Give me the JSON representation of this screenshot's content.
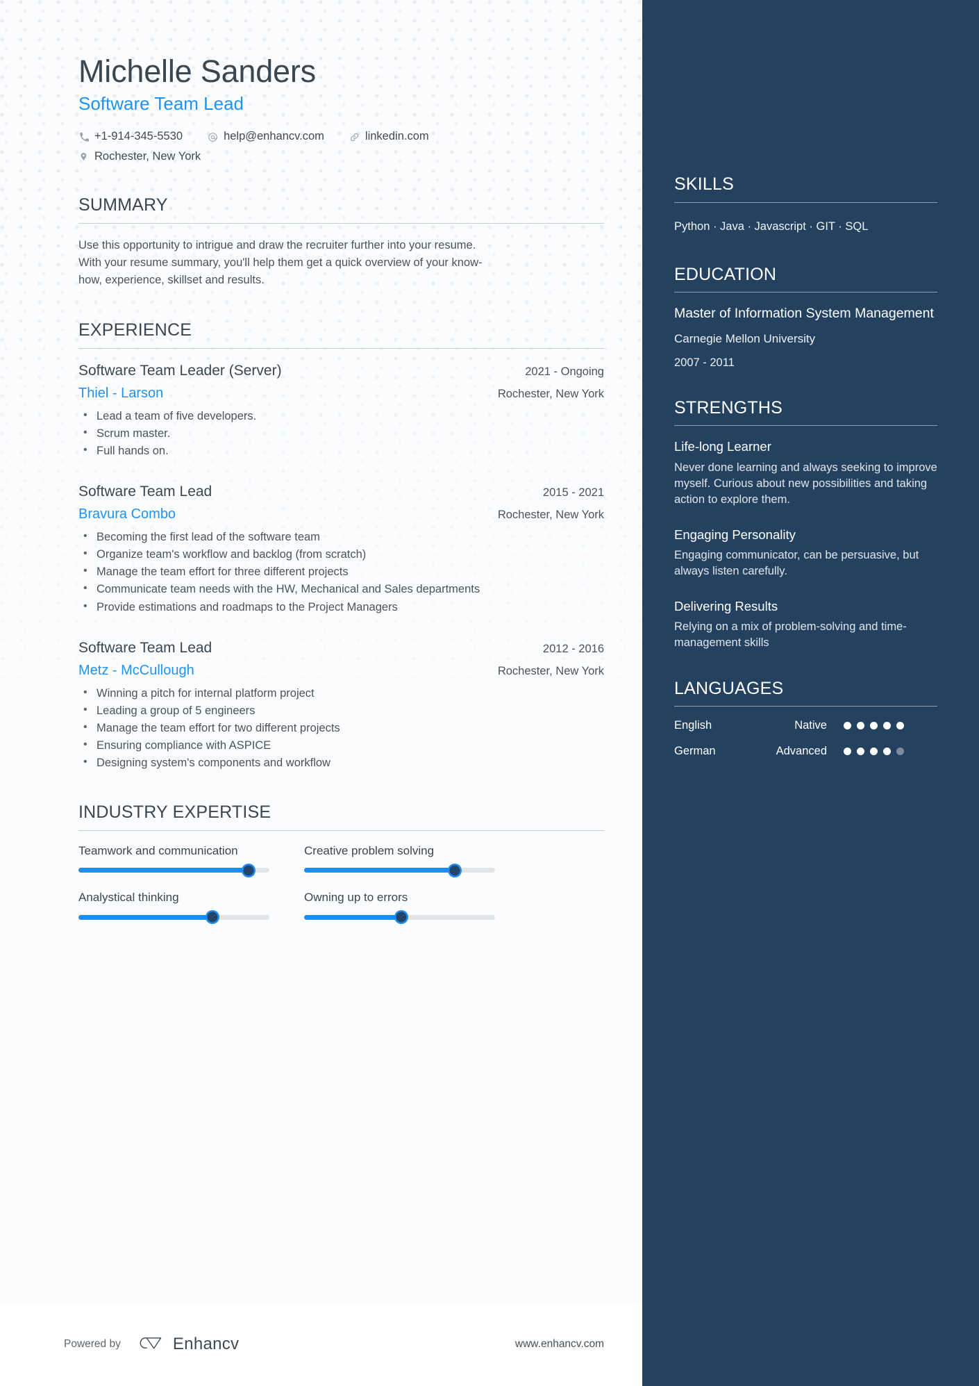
{
  "theme": {
    "accent_blue": "#1f93f2",
    "sidebar_navy": "#254160",
    "heading_gray": "#3a4750",
    "body_gray": "#4a545c"
  },
  "header": {
    "full_name": "Michelle Sanders",
    "job_title": "Software Team Lead",
    "contacts": [
      {
        "icon": "phone-icon",
        "value": "+1-914-345-5530"
      },
      {
        "icon": "email-icon",
        "value": "help@enhancv.com"
      },
      {
        "icon": "link-icon",
        "value": "linkedin.com"
      }
    ],
    "location": {
      "icon": "location-pin-icon",
      "value": "Rochester, New York"
    }
  },
  "summary": {
    "heading": "SUMMARY",
    "text": "Use this opportunity to intrigue and draw the recruiter further into your resume. With your resume summary, you'll help them get a quick overview of your know-how, experience, skillset and results."
  },
  "experience": {
    "heading": "EXPERIENCE",
    "items": [
      {
        "role": "Software Team Leader (Server)",
        "dates": "2021 - Ongoing",
        "company": "Thiel - Larson",
        "location": "Rochester, New York",
        "bullets": [
          "Lead a team of five developers.",
          "Scrum master.",
          "Full hands on."
        ]
      },
      {
        "role": "Software Team Lead",
        "dates": "2015 - 2021",
        "company": "Bravura Combo",
        "location": "Rochester, New York",
        "bullets": [
          "Becoming the first lead of the software team",
          "Organize team's workflow and backlog (from scratch)",
          "Manage the team effort for three different projects",
          "Communicate team needs with the HW, Mechanical and Sales departments",
          "Provide estimations and roadmaps to the Project Managers"
        ]
      },
      {
        "role": "Software Team Lead",
        "dates": "2012 - 2016",
        "company": "Metz - McCullough",
        "location": "Rochester, New York",
        "bullets": [
          "Winning a pitch for internal platform project",
          "Leading a group of 5 engineers",
          "Manage the team effort for two different projects",
          "Ensuring compliance with ASPICE",
          "Designing system's components and workflow"
        ]
      }
    ]
  },
  "industry_expertise": {
    "heading": "INDUSTRY EXPERTISE",
    "items": [
      {
        "label": "Teamwork and communication",
        "percent": 89
      },
      {
        "label": "Creative problem solving",
        "percent": 79
      },
      {
        "label": "Analystical thinking",
        "percent": 70
      },
      {
        "label": "Owning up to errors",
        "percent": 51
      }
    ]
  },
  "sidebar": {
    "skills": {
      "heading": "SKILLS",
      "list": "Python · Java · Javascript · GIT · SQL"
    },
    "education": {
      "heading": "EDUCATION",
      "items": [
        {
          "degree": "Master of Information System Management",
          "school": "Carnegie Mellon University",
          "dates": "2007 - 2011"
        }
      ]
    },
    "strengths": {
      "heading": "STRENGTHS",
      "items": [
        {
          "title": "Life-long Learner",
          "description": "Never done learning and always seeking to improve myself. Curious about new possibilities and taking action to explore them."
        },
        {
          "title": "Engaging Personality",
          "description": "Engaging communicator, can be persuasive, but always listen carefully."
        },
        {
          "title": "Delivering Results",
          "description": "Relying on a mix of problem-solving and time-management skills"
        }
      ]
    },
    "languages": {
      "heading": "LANGUAGES",
      "items": [
        {
          "name": "English",
          "level": "Native",
          "rating": 5,
          "max": 5
        },
        {
          "name": "German",
          "level": "Advanced",
          "rating": 4,
          "max": 5
        }
      ]
    }
  },
  "footer": {
    "powered_by": "Powered by",
    "brand": "Enhancv",
    "website": "www.enhancv.com"
  }
}
